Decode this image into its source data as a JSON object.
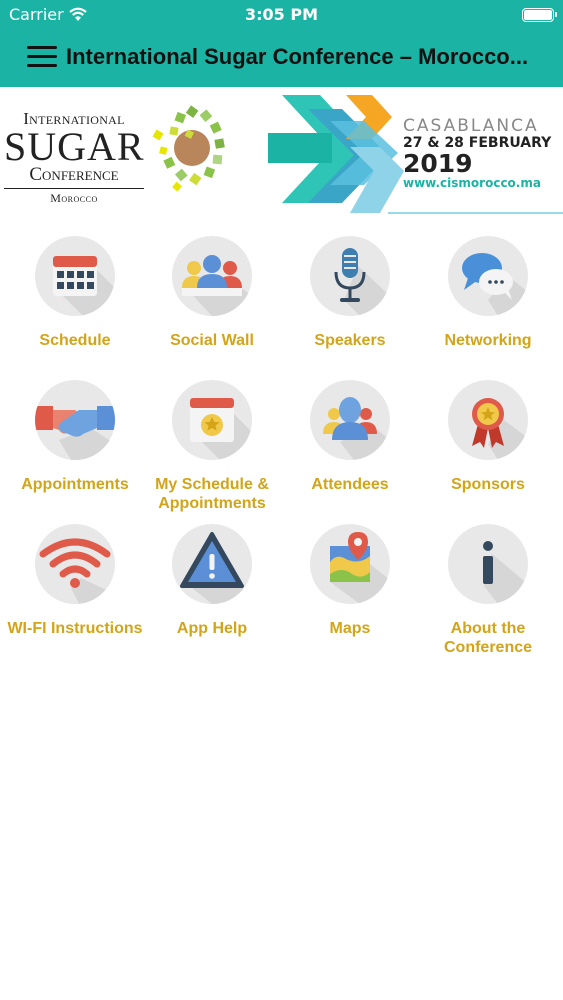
{
  "status": {
    "carrier": "Carrier",
    "time": "3:05 PM"
  },
  "nav": {
    "title": "International Sugar Conference – Morocco..."
  },
  "banner": {
    "brand_line1": "International",
    "brand_line2": "SUGAR",
    "brand_line3": "Conference",
    "brand_line4": "Morocco",
    "city": "CASABLANCA",
    "dates": "27 & 28 FEBRUARY",
    "year": "2019",
    "url": "www.cismorocco.ma"
  },
  "colors": {
    "header": "#1bb4a4",
    "label": "#d4a418",
    "circle": "#e8e8e8"
  },
  "menu": [
    {
      "label": "Schedule",
      "icon": "calendar-icon"
    },
    {
      "label": "Social Wall",
      "icon": "people-icon"
    },
    {
      "label": "Speakers",
      "icon": "microphone-icon"
    },
    {
      "label": "Networking",
      "icon": "chat-bubbles-icon"
    },
    {
      "label": "Appointments",
      "icon": "handshake-icon"
    },
    {
      "label": "My Schedule & Appointments",
      "icon": "starred-calendar-icon"
    },
    {
      "label": "Attendees",
      "icon": "group-icon"
    },
    {
      "label": "Sponsors",
      "icon": "award-ribbon-icon"
    },
    {
      "label": "WI-FI Instructions",
      "icon": "wifi-icon"
    },
    {
      "label": "App Help",
      "icon": "warning-icon"
    },
    {
      "label": "Maps",
      "icon": "map-icon"
    },
    {
      "label": "About the Conference",
      "icon": "info-icon"
    }
  ]
}
